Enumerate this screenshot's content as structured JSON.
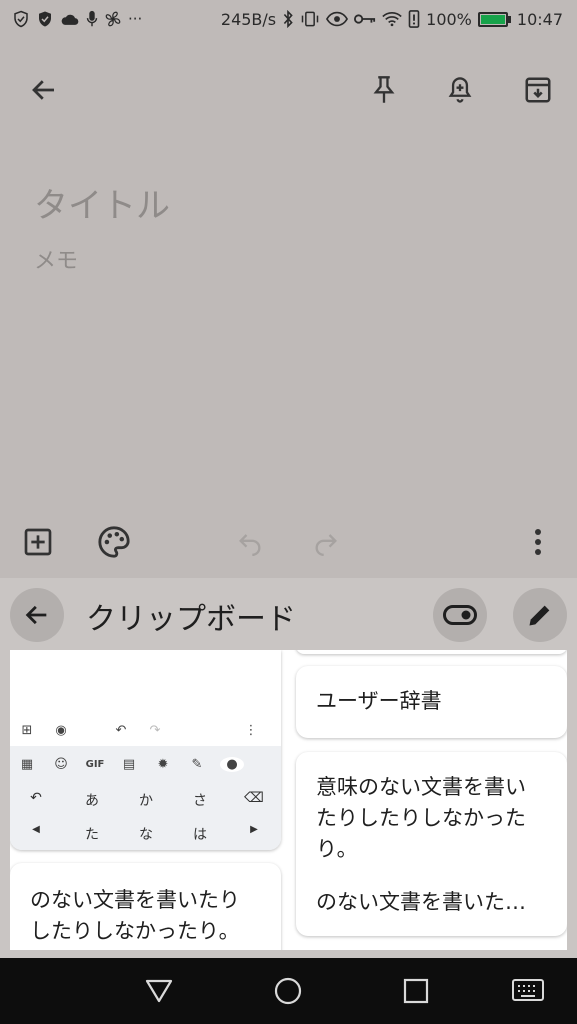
{
  "status_bar": {
    "left_icons": [
      "vpn-shield-icon",
      "verified-shield-icon",
      "cloud-icon",
      "mic-icon",
      "fan-icon",
      "more-icon"
    ],
    "more_glyph": "···",
    "speed": "245B/s",
    "right_icons": [
      "bluetooth-icon",
      "vibrate-icon",
      "eye-icon",
      "key-icon",
      "wifi-icon",
      "alert-icon"
    ],
    "battery_percent": "100%",
    "time": "10:47"
  },
  "note": {
    "title_placeholder": "タイトル",
    "body_placeholder": "メモ",
    "top_actions": [
      "back-arrow-icon",
      "pin-icon",
      "reminder-bell-icon",
      "archive-icon"
    ],
    "bottom_actions": [
      "add-box-icon",
      "palette-icon",
      "undo-icon",
      "redo-icon",
      "more-vert-icon"
    ]
  },
  "clipboard": {
    "title": "クリップボード",
    "left_cards": [
      {
        "type": "image",
        "mini_keyboard": {
          "gif_label": "GIF",
          "keys_row1": [
            "あ",
            "か",
            "さ"
          ],
          "keys_row2": [
            "た",
            "な",
            "は"
          ]
        }
      },
      {
        "type": "text",
        "text_lines": [
          "のない文書を書いたり",
          "したりしなかったり。"
        ]
      }
    ],
    "right_cards": [
      {
        "type": "text",
        "text_lines": [
          "ユーザー辞書"
        ]
      },
      {
        "type": "text",
        "text_lines": [
          "意味のない文書を書い",
          "たりしたりしなかった",
          "り。",
          "",
          "のない文書を書いた…"
        ]
      }
    ]
  },
  "nav": {
    "buttons": [
      "back-triangle-icon",
      "home-circle-icon",
      "recents-square-icon",
      "keyboard-icon"
    ]
  },
  "colors": {
    "dim_background": "#bfbab8",
    "panel_background": "#c9c5c3",
    "battery_fill": "#17a34a",
    "nav_background": "#0d0d0d"
  }
}
